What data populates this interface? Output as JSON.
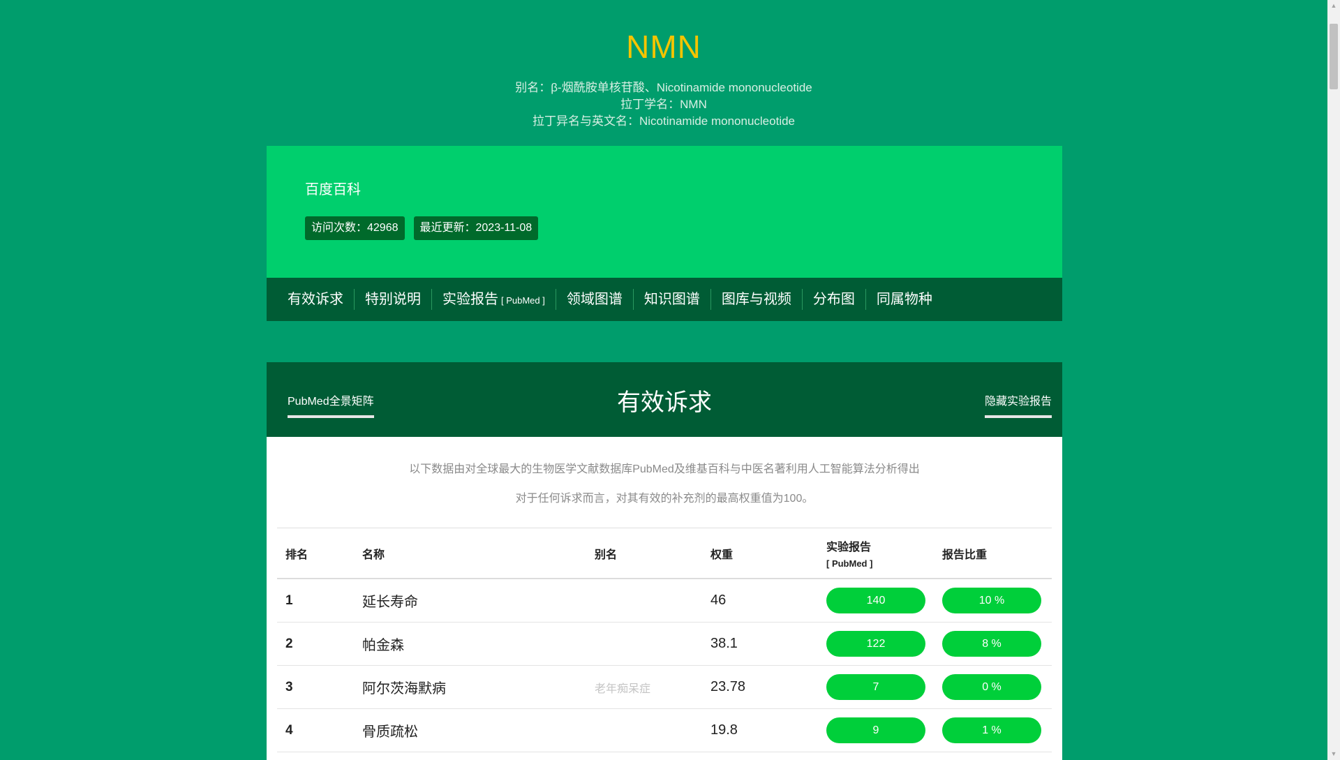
{
  "header": {
    "title": "NMN",
    "alias_line": "别名：β-烟酰胺单核苷酸、Nicotinamide mononucleotide",
    "latin_line": "拉丁学名：NMN",
    "latin_alt_line": "拉丁异名与英文名：Nicotinamide mononucleotide"
  },
  "info": {
    "source": "百度百科",
    "visits": "访问次数：42968",
    "updated": "最近更新：2023-11-08"
  },
  "nav": {
    "items": [
      "有效诉求",
      "特别说明",
      "实验报告",
      "领域图谱",
      "知识图谱",
      "图库与视频",
      "分布图",
      "同属物种"
    ],
    "pubmed_tag": "[ PubMed ]"
  },
  "section": {
    "title": "有效诉求",
    "left_tab": "PubMed全景矩阵",
    "right_tab": "隐藏实验报告",
    "desc1": "以下数据由对全球最大的生物医学文献数据库PubMed及维基百科与中医名著利用人工智能算法分析得出",
    "desc2": "对于任何诉求而言，对其有效的补充剂的最高权重值为100。"
  },
  "table": {
    "headers": {
      "rank": "排名",
      "name": "名称",
      "alias": "别名",
      "weight": "权重",
      "reports": "实验报告",
      "reports_sub": "[ PubMed ]",
      "ratio": "报告比重"
    },
    "rows": [
      {
        "rank": "1",
        "name": "延长寿命",
        "alias": "",
        "weight": "46",
        "reports": "140",
        "ratio": "10 %"
      },
      {
        "rank": "2",
        "name": "帕金森",
        "alias": "",
        "weight": "38.1",
        "reports": "122",
        "ratio": "8 %"
      },
      {
        "rank": "3",
        "name": "阿尔茨海默病",
        "alias": "老年痴呆症",
        "weight": "23.78",
        "reports": "7",
        "ratio": "0 %"
      },
      {
        "rank": "4",
        "name": "骨质疏松",
        "alias": "",
        "weight": "19.8",
        "reports": "9",
        "ratio": "1 %"
      }
    ]
  },
  "colors": {
    "background": "#009d6c",
    "title": "#f5c400",
    "panel": "#00cf6d",
    "nav": "#005c35",
    "pill": "#00cf3a"
  }
}
